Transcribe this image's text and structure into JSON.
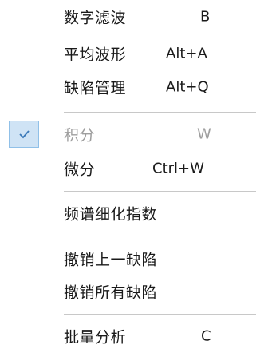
{
  "menu": {
    "items": [
      {
        "label": "数字滤波",
        "shortcut": "B"
      },
      {
        "label": "平均波形",
        "shortcut": "Alt+A"
      },
      {
        "label": "缺陷管理",
        "shortcut": "Alt+Q"
      },
      {
        "label": "积分",
        "shortcut": "W",
        "checked": true,
        "disabled": true
      },
      {
        "label": "微分",
        "shortcut": "Ctrl+W"
      },
      {
        "label": "频谱细化指数",
        "shortcut": ""
      },
      {
        "label": "撤销上一缺陷",
        "shortcut": ""
      },
      {
        "label": "撤销所有缺陷",
        "shortcut": ""
      },
      {
        "label": "批量分析",
        "shortcut": "C"
      }
    ],
    "check_icon": "checkmark-icon",
    "colors": {
      "checked_bg": "#cfe3f5",
      "checked_border": "#90c0e8",
      "check_mark": "#3a78b8",
      "disabled_text": "#9e9e9e",
      "separator": "#c8c8c8"
    }
  }
}
